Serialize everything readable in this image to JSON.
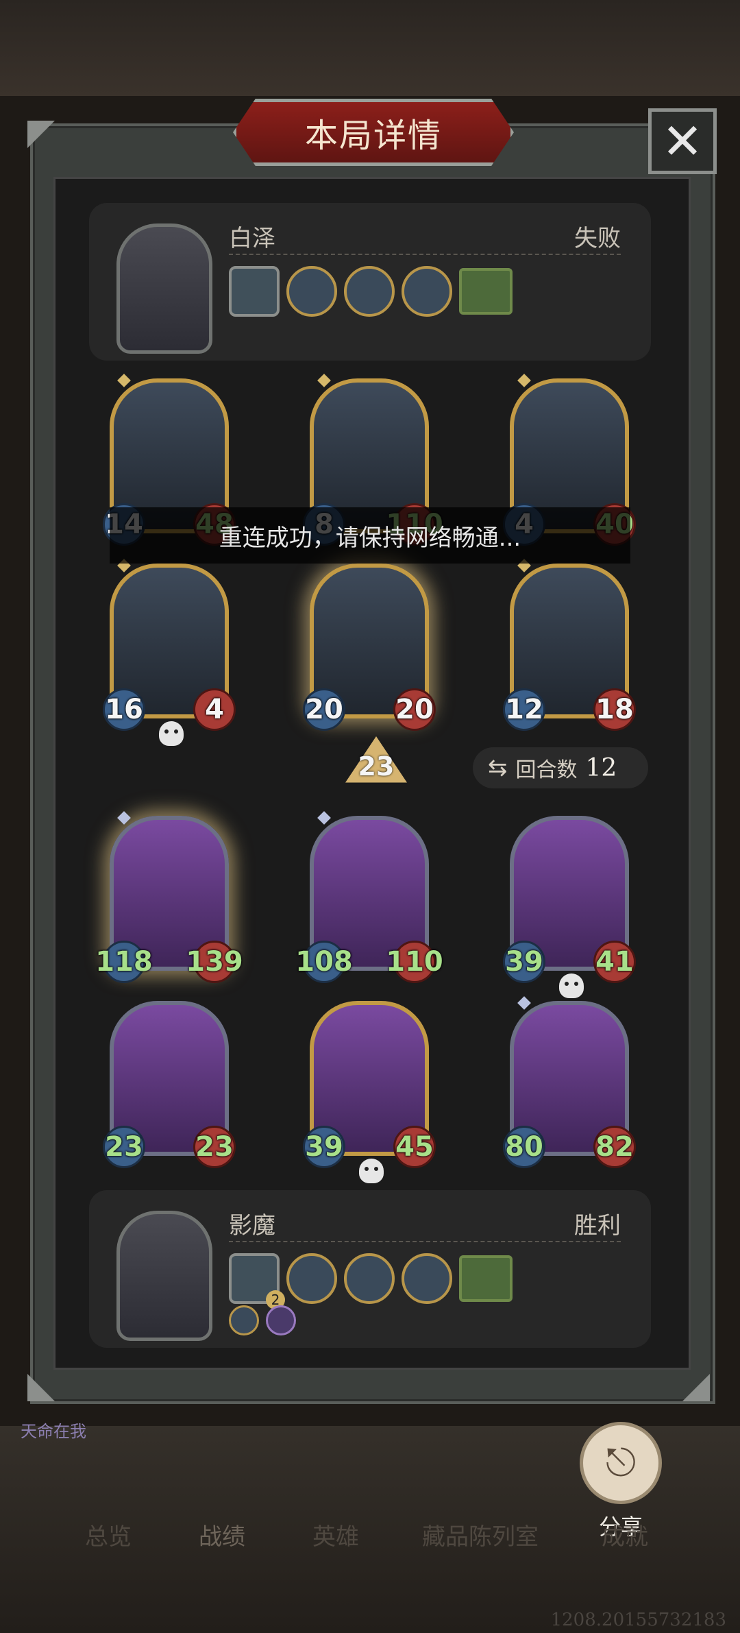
{
  "title": "本局详情",
  "toast": "重连成功，请保持网络畅通...",
  "close_icon": "close-icon",
  "top_player": {
    "name": "白泽",
    "result": "失败"
  },
  "bottom_player": {
    "name": "影魔",
    "result": "胜利",
    "badge": "2"
  },
  "top_board": [
    {
      "atk": "14",
      "hp": "48",
      "atk_buff": false,
      "hp_buff": true
    },
    {
      "atk": "8",
      "hp": "110",
      "atk_buff": false,
      "hp_buff": true
    },
    {
      "atk": "4",
      "hp": "40",
      "atk_buff": false,
      "hp_buff": true
    },
    {
      "atk": "16",
      "hp": "4",
      "atk_buff": false,
      "hp_buff": false,
      "dead": true
    },
    {
      "atk": "20",
      "hp": "20",
      "atk_buff": false,
      "hp_buff": false
    },
    {
      "atk": "12",
      "hp": "18",
      "atk_buff": false,
      "hp_buff": false
    }
  ],
  "bottom_board": [
    {
      "atk": "118",
      "hp": "139",
      "atk_buff": true,
      "hp_buff": true
    },
    {
      "atk": "108",
      "hp": "110",
      "atk_buff": true,
      "hp_buff": true
    },
    {
      "atk": "39",
      "hp": "41",
      "atk_buff": true,
      "hp_buff": true,
      "dead": true
    },
    {
      "atk": "23",
      "hp": "23",
      "atk_buff": true,
      "hp_buff": true
    },
    {
      "atk": "39",
      "hp": "45",
      "atk_buff": true,
      "hp_buff": true,
      "dead": true
    },
    {
      "atk": "80",
      "hp": "82",
      "atk_buff": true,
      "hp_buff": true
    }
  ],
  "tier": "23",
  "rounds": {
    "label": "回合数",
    "value": "12"
  },
  "share_label": "分享",
  "nav": [
    "总览",
    "战绩",
    "英雄",
    "藏品陈列室",
    "成就"
  ],
  "side_tag": "天命在我",
  "footer_id": "1208.20155732183"
}
